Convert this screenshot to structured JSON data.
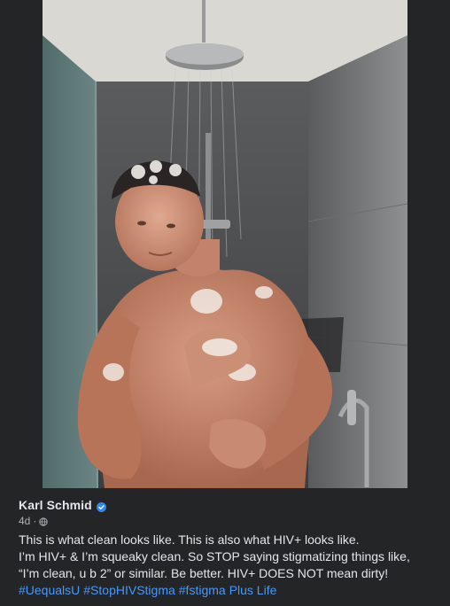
{
  "post": {
    "author": "Karl Schmid",
    "verified": true,
    "time": "4d",
    "separator": "·",
    "privacy_icon": "globe-icon",
    "lines": [
      "This is what clean looks like. This is also what HIV+ looks like.",
      "I’m HIV+ & I’m squeaky clean. So STOP saying stigmatizing things like,",
      "“I’m clean, u b 2” or similar. Be better. HIV+ DOES NOT mean dirty!"
    ],
    "hashtags": [
      "#UequalsU",
      "#StopHIVStigma",
      "#fstigma",
      "Plus Life"
    ]
  },
  "colors": {
    "background": "#242526",
    "text": "#e4e6eb",
    "secondary_text": "#b0b3b8",
    "link": "#4599ff",
    "verified_badge": "#2d88ff"
  },
  "photo": {
    "description_icon": "shower-photo"
  }
}
